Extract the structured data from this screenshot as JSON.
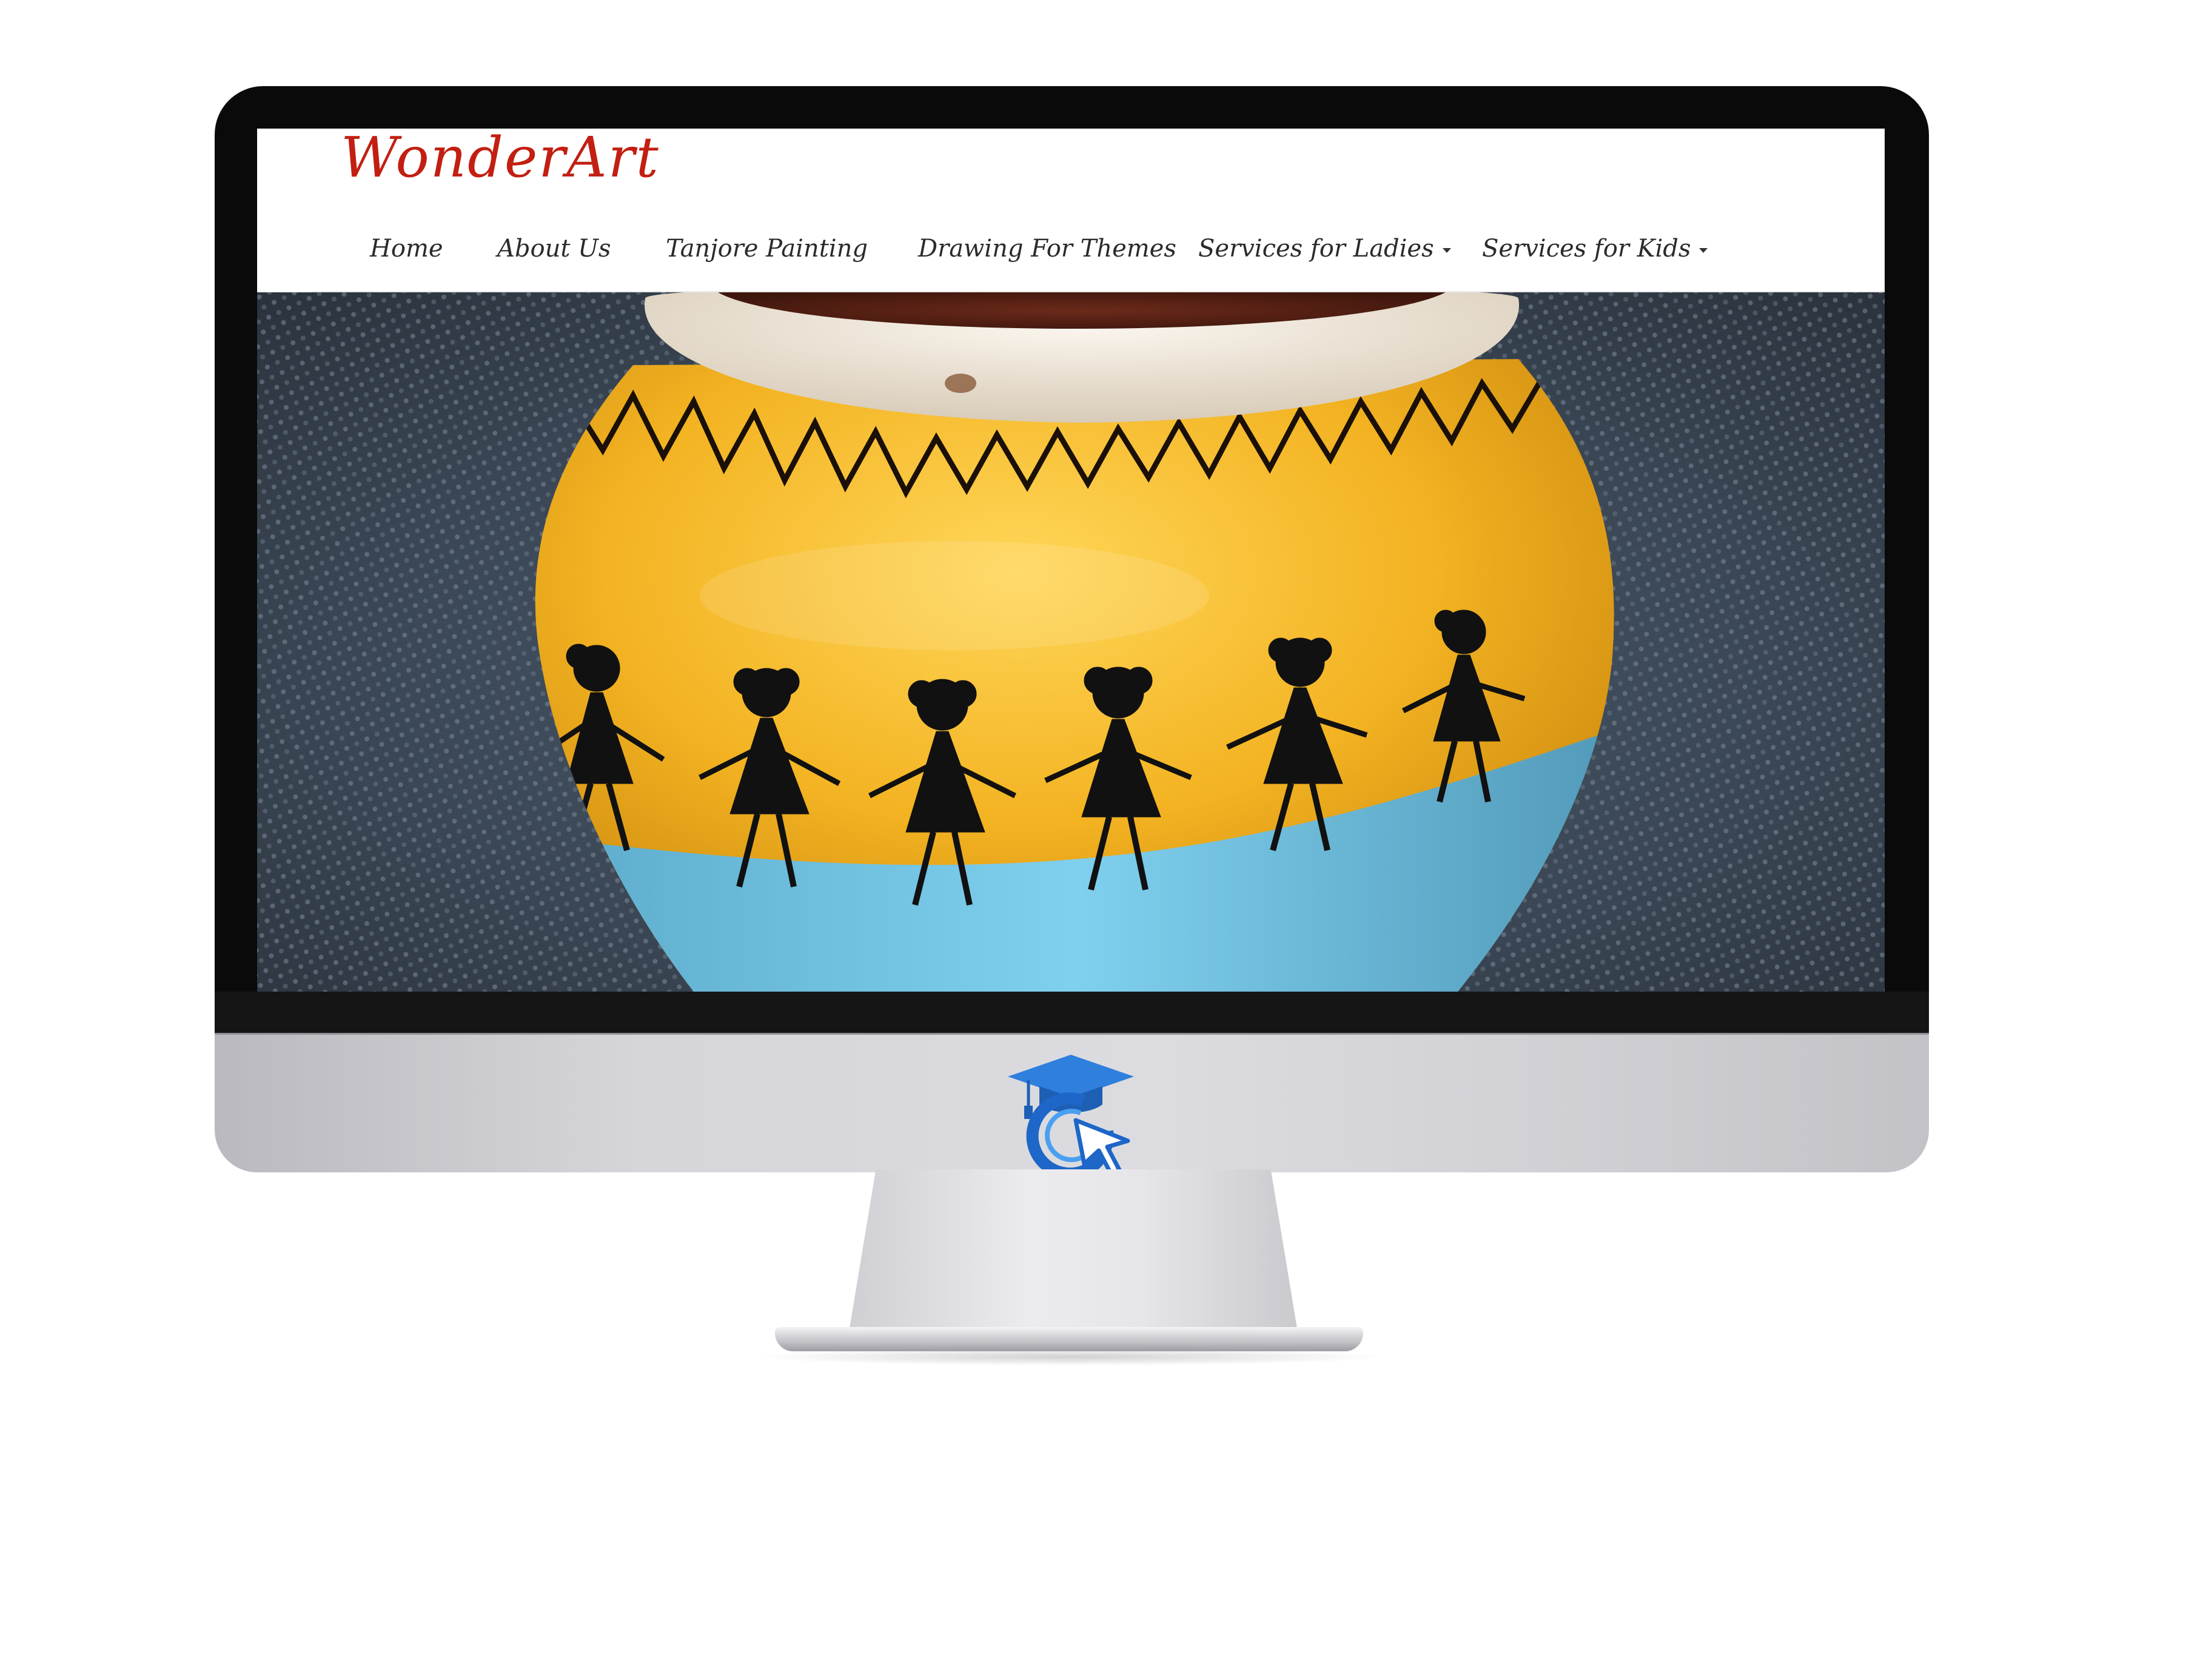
{
  "site": {
    "logo_text": "WonderArt"
  },
  "nav": {
    "items": [
      {
        "label": "Home",
        "has_dropdown": false
      },
      {
        "label": "About Us",
        "has_dropdown": false
      },
      {
        "label": "Tanjore Painting",
        "has_dropdown": false
      },
      {
        "label": "Drawing For Themes",
        "has_dropdown": false
      },
      {
        "label": "Services for Ladies",
        "has_dropdown": true
      },
      {
        "label": "Services for Kids",
        "has_dropdown": true
      }
    ]
  },
  "hero": {
    "image": "painted-clay-pot-warli-art",
    "colors": {
      "pot_yellow": "#f2b21f",
      "pot_blue": "#6fc3e2",
      "rim_white": "#efe7dc",
      "figures": "#111111"
    }
  },
  "device": {
    "brand_icon": "graduation-cap-cursor-logo",
    "brand_color": "#1f6fd0"
  }
}
